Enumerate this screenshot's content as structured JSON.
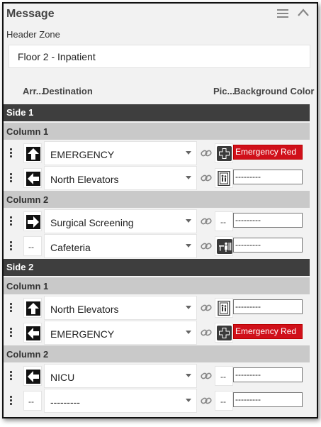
{
  "panel": {
    "title": "Message",
    "header_zone_label": "Header Zone",
    "header_zone_value": "Floor 2 - Inpatient"
  },
  "columns": {
    "arrow": "Arr...",
    "destination": "Destination",
    "picture": "Pic...",
    "background": "Background Color"
  },
  "sides": [
    {
      "label": "Side 1",
      "columns": [
        {
          "label": "Column 1",
          "rows": [
            {
              "arrow": "up",
              "destination": "EMERGENCY",
              "picture": "first-aid-cross",
              "background": "Emergency Red",
              "bg_color": "#d0101a"
            },
            {
              "arrow": "left",
              "destination": "North Elevators",
              "picture": "elevator",
              "background": "---------",
              "bg_color": "#ffffff"
            }
          ]
        },
        {
          "label": "Column 2",
          "rows": [
            {
              "arrow": "right",
              "destination": "Surgical Screening",
              "picture": "none",
              "background": "---------",
              "bg_color": "#ffffff"
            },
            {
              "arrow": "none",
              "destination": "Cafeteria",
              "picture": "cafeteria",
              "background": "---------",
              "bg_color": "#ffffff"
            }
          ]
        }
      ]
    },
    {
      "label": "Side 2",
      "columns": [
        {
          "label": "Column 1",
          "rows": [
            {
              "arrow": "up",
              "destination": "North Elevators",
              "picture": "elevator",
              "background": "---------",
              "bg_color": "#ffffff"
            },
            {
              "arrow": "left",
              "destination": "EMERGENCY",
              "picture": "first-aid-cross",
              "background": "Emergency Red",
              "bg_color": "#d0101a"
            }
          ]
        },
        {
          "label": "Column 2",
          "rows": [
            {
              "arrow": "left",
              "destination": "NICU",
              "picture": "none",
              "background": "---------",
              "bg_color": "#ffffff"
            },
            {
              "arrow": "none",
              "destination": "---------",
              "picture": "none",
              "background": "---------",
              "bg_color": "#ffffff"
            }
          ]
        }
      ]
    }
  ],
  "empty_glyph": "--"
}
